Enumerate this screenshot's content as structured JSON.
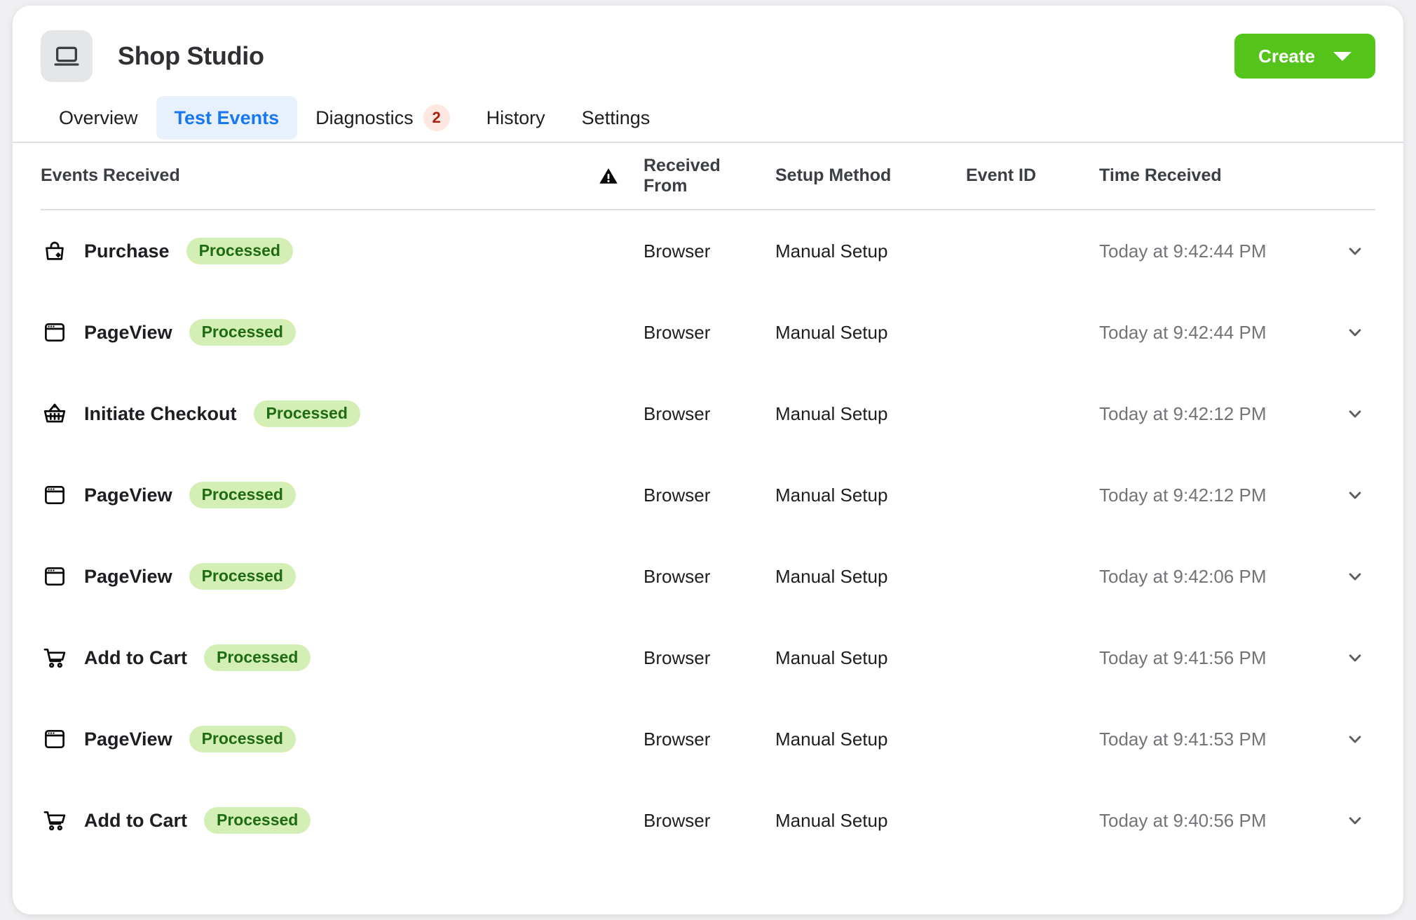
{
  "app": {
    "title": "Shop Studio",
    "icon": "laptop-icon",
    "accent_green": "#54c31a",
    "accent_blue": "#1877f2",
    "badge_bg": "#fde7e0",
    "badge_text_color": "#a81f0c",
    "status_bg": "#d3efb5",
    "status_text_color": "#1e6b14"
  },
  "toolbar": {
    "create_label": "Create",
    "create_caret": "chevron-down-icon"
  },
  "tabs": [
    {
      "label": "Overview",
      "active": false,
      "badge": null
    },
    {
      "label": "Test Events",
      "active": true,
      "badge": null
    },
    {
      "label": "Diagnostics",
      "active": false,
      "badge": "2"
    },
    {
      "label": "History",
      "active": false,
      "badge": null
    },
    {
      "label": "Settings",
      "active": false,
      "badge": null
    }
  ],
  "table": {
    "headers": {
      "events_received": "Events Received",
      "warning_icon": "warning-triangle-icon",
      "received_from": "Received From",
      "setup_method": "Setup Method",
      "event_id": "Event ID",
      "time_received": "Time Received"
    },
    "rows": [
      {
        "icon": "shopping-bag-icon",
        "event": "Purchase",
        "status": "Processed",
        "received_from": "Browser",
        "setup_method": "Manual Setup",
        "event_id": "",
        "time_received": "Today at 9:42:44 PM"
      },
      {
        "icon": "browser-window-icon",
        "event": "PageView",
        "status": "Processed",
        "received_from": "Browser",
        "setup_method": "Manual Setup",
        "event_id": "",
        "time_received": "Today at 9:42:44 PM"
      },
      {
        "icon": "basket-icon",
        "event": "Initiate Checkout",
        "status": "Processed",
        "received_from": "Browser",
        "setup_method": "Manual Setup",
        "event_id": "",
        "time_received": "Today at 9:42:12 PM"
      },
      {
        "icon": "browser-window-icon",
        "event": "PageView",
        "status": "Processed",
        "received_from": "Browser",
        "setup_method": "Manual Setup",
        "event_id": "",
        "time_received": "Today at 9:42:12 PM"
      },
      {
        "icon": "browser-window-icon",
        "event": "PageView",
        "status": "Processed",
        "received_from": "Browser",
        "setup_method": "Manual Setup",
        "event_id": "",
        "time_received": "Today at 9:42:06 PM"
      },
      {
        "icon": "shopping-cart-icon",
        "event": "Add to Cart",
        "status": "Processed",
        "received_from": "Browser",
        "setup_method": "Manual Setup",
        "event_id": "",
        "time_received": "Today at 9:41:56 PM"
      },
      {
        "icon": "browser-window-icon",
        "event": "PageView",
        "status": "Processed",
        "received_from": "Browser",
        "setup_method": "Manual Setup",
        "event_id": "",
        "time_received": "Today at 9:41:53 PM"
      },
      {
        "icon": "shopping-cart-icon",
        "event": "Add to Cart",
        "status": "Processed",
        "received_from": "Browser",
        "setup_method": "Manual Setup",
        "event_id": "",
        "time_received": "Today at 9:40:56 PM"
      }
    ]
  }
}
